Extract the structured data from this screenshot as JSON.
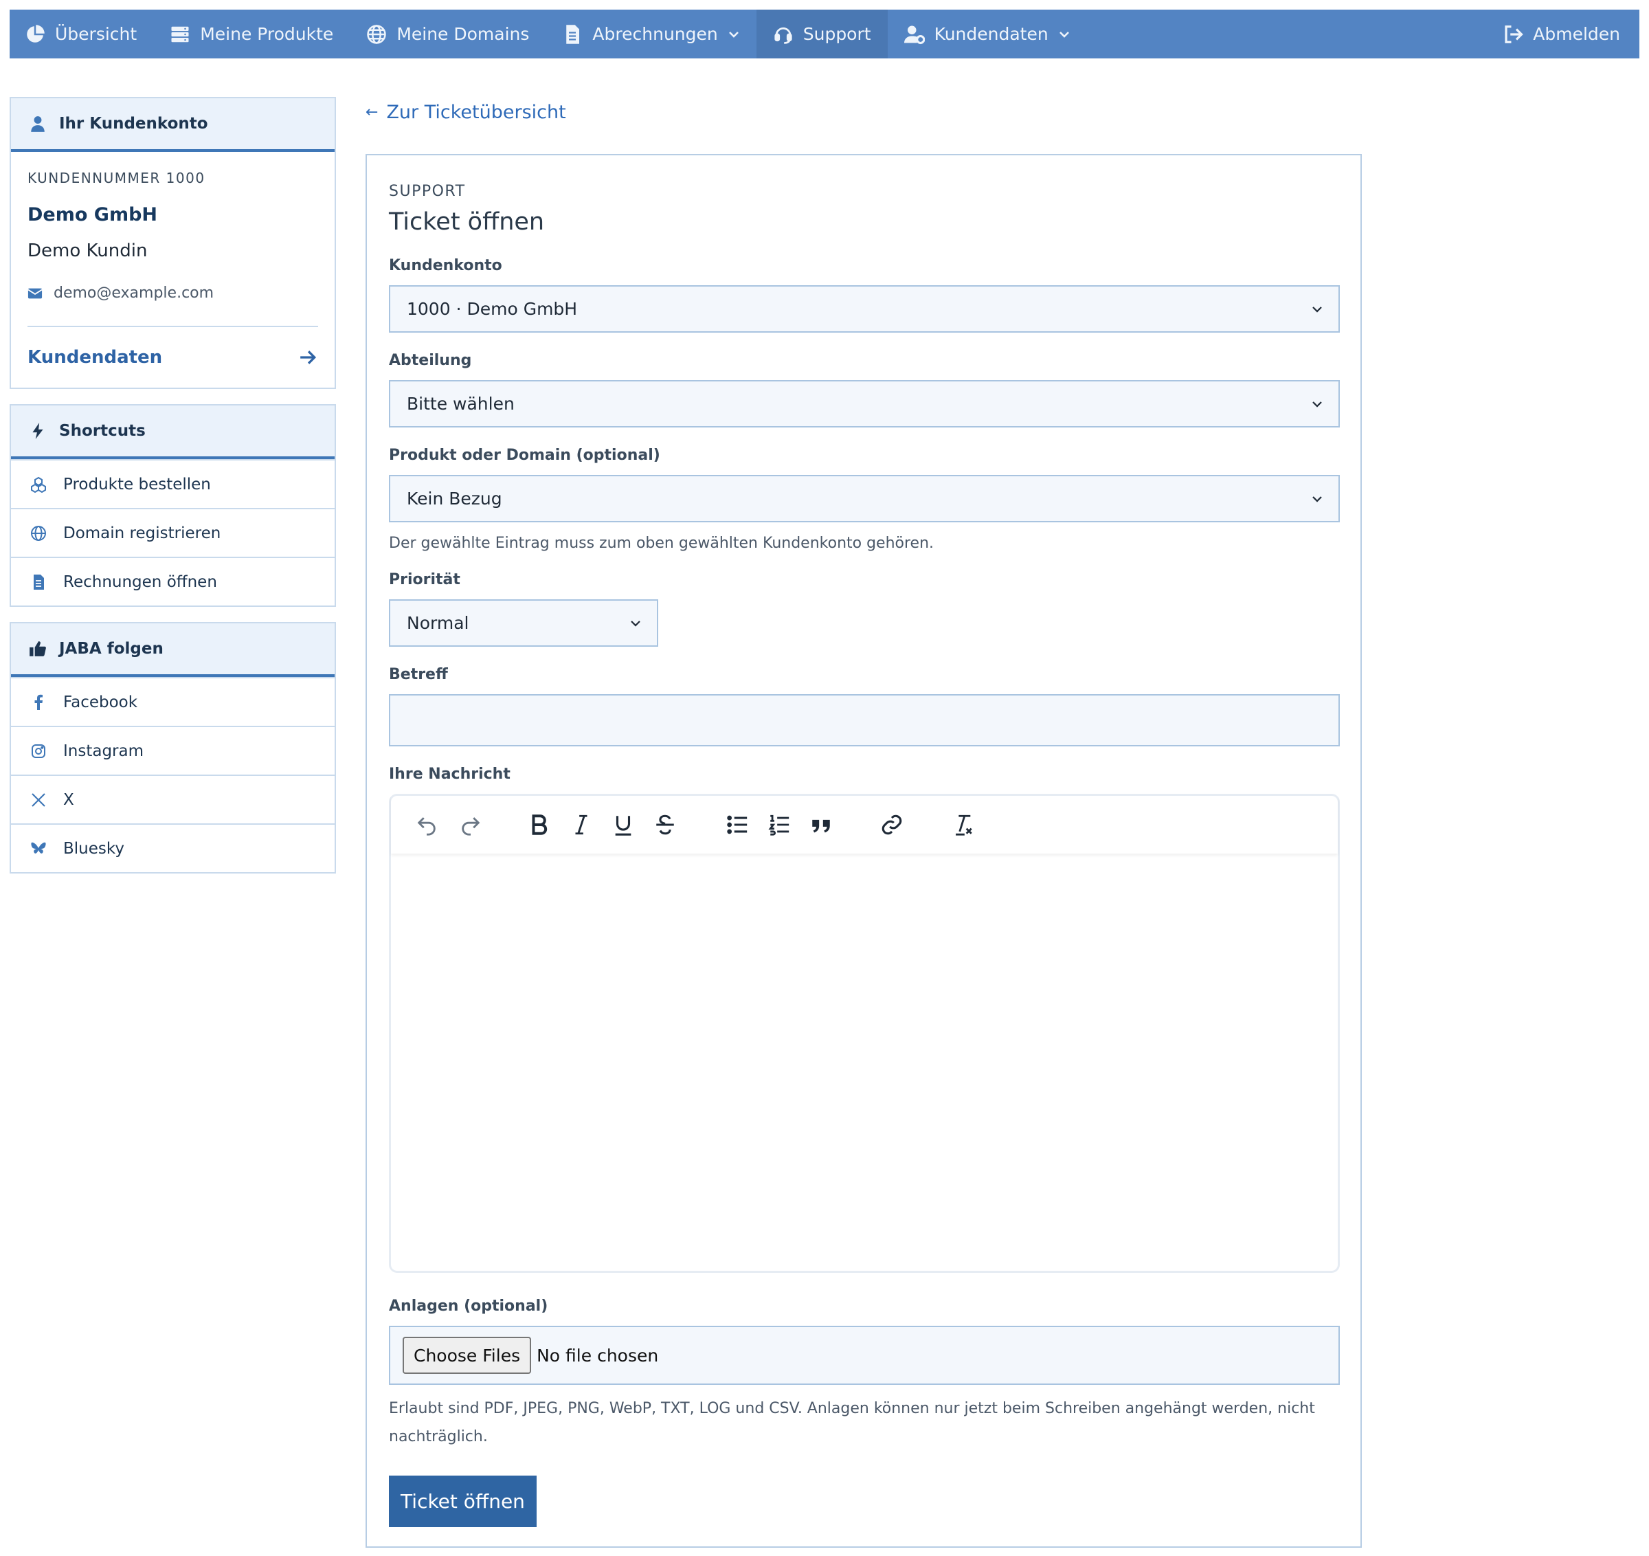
{
  "nav": {
    "items": [
      {
        "label": "Übersicht",
        "icon": "chart-pie-icon"
      },
      {
        "label": "Meine Produkte",
        "icon": "server-icon"
      },
      {
        "label": "Meine Domains",
        "icon": "globe-icon"
      },
      {
        "label": "Abrechnungen",
        "icon": "document-icon"
      },
      {
        "label": "Support",
        "icon": "headset-icon"
      },
      {
        "label": "Kundendaten",
        "icon": "user-gear-icon"
      }
    ],
    "logout": "Abmelden"
  },
  "sidebar": {
    "account": {
      "heading": "Ihr Kundenkonto",
      "number": "KUNDENNUMMER 1000",
      "company": "Demo GmbH",
      "person": "Demo Kundin",
      "email": "demo@example.com",
      "link": "Kundendaten"
    },
    "shortcuts": {
      "heading": "Shortcuts",
      "items": [
        "Produkte bestellen",
        "Domain registrieren",
        "Rechnungen öffnen"
      ]
    },
    "follow": {
      "heading": "JABA folgen",
      "items": [
        "Facebook",
        "Instagram",
        "X",
        "Bluesky"
      ]
    }
  },
  "main": {
    "back_link": "Zur Ticketübersicht",
    "back_arrow": "←",
    "kicker": "SUPPORT",
    "title": "Ticket öffnen",
    "account_label": "Kundenkonto",
    "account_value": "1000 · Demo GmbH",
    "department_label": "Abteilung",
    "department_value": "Bitte wählen",
    "product_label": "Produkt oder Domain (optional)",
    "product_value": "Kein Bezug",
    "product_hint": "Der gewählte Eintrag muss zum oben gewählten Kundenkonto gehören.",
    "priority_label": "Priorität",
    "priority_value": "Normal",
    "subject_label": "Betreff",
    "subject_value": "",
    "message_label": "Ihre Nachricht",
    "attachments_label": "Anlagen (optional)",
    "file_button": "Choose Files",
    "file_status": "No file chosen",
    "attachments_hint": "Erlaubt sind PDF, JPEG, PNG, WebP, TXT, LOG und CSV. Anlagen können nur jetzt beim Schreiben angehängt werden, nicht nachträglich.",
    "submit": "Ticket öffnen"
  },
  "colors": {
    "nav_bg": "#5384c3",
    "nav_active": "#4a78b3",
    "accent": "#2f65a3",
    "panel_head_bg": "#eaf2fb",
    "field_bg": "#f3f7fc",
    "field_border": "#a9c4e0"
  }
}
